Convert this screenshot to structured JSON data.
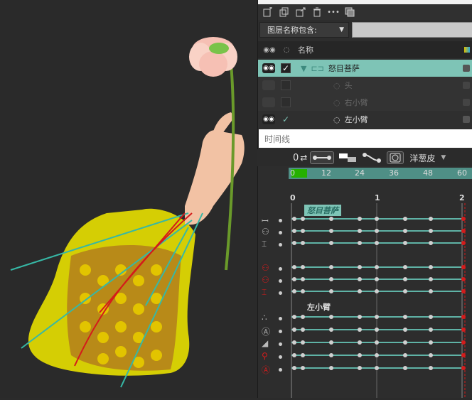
{
  "toolbar": {
    "icons": [
      "new-layer-icon",
      "duplicate-icon",
      "export-icon",
      "delete-icon",
      "more-icon",
      "stack-icon"
    ],
    "more_label": "•••"
  },
  "filter": {
    "label": "图层名称包含:",
    "arrow": "▼",
    "value": ""
  },
  "columns": {
    "name": "名称"
  },
  "layers": [
    {
      "name": "怒目菩萨",
      "state": "selected",
      "visible": true,
      "checked": true
    },
    {
      "name": "头",
      "state": "dim",
      "visible": false,
      "checked": false
    },
    {
      "name": "右小臂",
      "state": "dim",
      "visible": false,
      "checked": false
    },
    {
      "name": "左小臂",
      "state": "normal",
      "visible": true,
      "checked": true
    }
  ],
  "tooltip": "时间线",
  "timeline": {
    "counter": "0",
    "dropdown_label": "洋葱皮",
    "dropdown_arrow": "▼",
    "frame_ticks": [
      "0",
      "12",
      "24",
      "36",
      "48",
      "60"
    ],
    "second_ticks": [
      "0",
      "1",
      "2"
    ],
    "group_labels": [
      "怒目菩萨",
      "左小臂"
    ]
  },
  "colors": {
    "accent": "#7ec4b6",
    "ruler": "#4f8f86",
    "keyframe_red": "#d41b1b",
    "track_line": "#5fb3a6"
  }
}
